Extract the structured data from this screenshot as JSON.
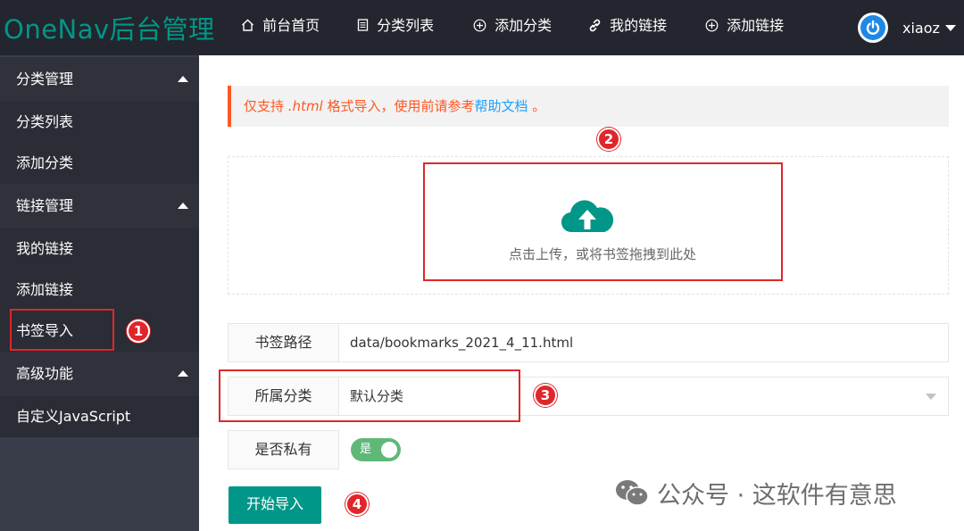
{
  "header": {
    "logo": "OneNav后台管理",
    "nav": [
      {
        "icon": "home-icon",
        "label": "前台首页"
      },
      {
        "icon": "list-icon",
        "label": "分类列表"
      },
      {
        "icon": "plus-circle-icon",
        "label": "添加分类"
      },
      {
        "icon": "link-icon",
        "label": "我的链接"
      },
      {
        "icon": "plus-circle-icon",
        "label": "添加链接"
      }
    ],
    "user": {
      "name": "xiaoz"
    }
  },
  "sidebar": {
    "groups": [
      {
        "title": "分类管理",
        "items": [
          "分类列表",
          "添加分类"
        ]
      },
      {
        "title": "链接管理",
        "items": [
          "我的链接",
          "添加链接",
          "书签导入"
        ]
      },
      {
        "title": "高级功能",
        "items": [
          "自定义JavaScript"
        ]
      }
    ]
  },
  "notice": {
    "prefix": "仅支持 ",
    "format": ".html",
    "middle": " 格式导入，使用前请参考",
    "link": "帮助文档",
    "suffix": " 。"
  },
  "upload": {
    "text": "点击上传，或将书签拖拽到此处"
  },
  "form": {
    "path": {
      "label": "书签路径",
      "value": "data/bookmarks_2021_4_11.html"
    },
    "category": {
      "label": "所属分类",
      "value": "默认分类"
    },
    "private": {
      "label": "是否私有",
      "toggle_text": "是",
      "on": true
    },
    "submit": "开始导入"
  },
  "annotations": [
    "1",
    "2",
    "3",
    "4"
  ],
  "watermark": {
    "text": "公众号 · 这软件有意思"
  },
  "colors": {
    "accent": "#009688",
    "header": "#23262e",
    "sidebar": "#393d49",
    "annotation": "#e0262a",
    "notice": "#ff5722",
    "link": "#1e9fff",
    "toggle": "#5fb878"
  }
}
